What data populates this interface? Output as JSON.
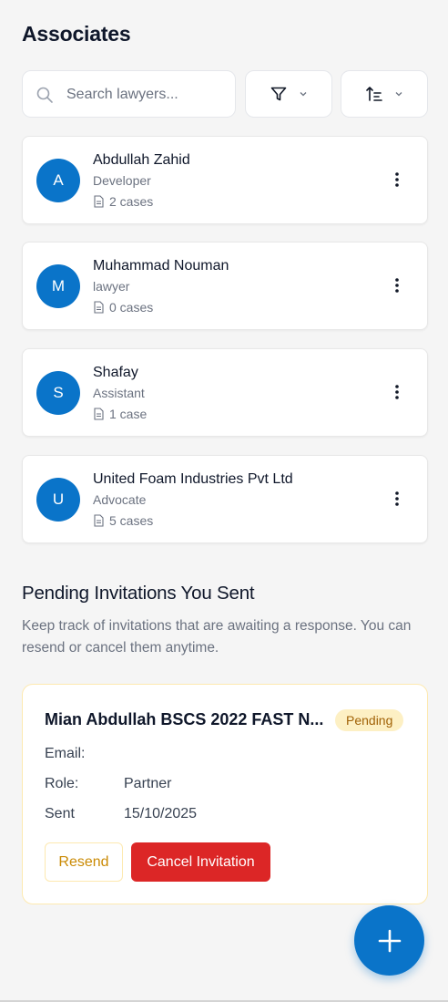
{
  "header": {
    "title": "Associates"
  },
  "search": {
    "placeholder": "Search lawyers..."
  },
  "toolbar": {
    "filter_icon": "filter-icon",
    "sort_icon": "sort-icon"
  },
  "associates": [
    {
      "initial": "A",
      "name": "Abdullah Zahid",
      "role": "Developer",
      "cases": "2 cases"
    },
    {
      "initial": "M",
      "name": "Muhammad Nouman",
      "role": "lawyer",
      "cases": "0 cases"
    },
    {
      "initial": "S",
      "name": "Shafay",
      "role": "Assistant",
      "cases": "1 case"
    },
    {
      "initial": "U",
      "name": "United Foam Industries Pvt Ltd",
      "role": "Advocate",
      "cases": "5 cases"
    }
  ],
  "pending": {
    "title": "Pending Invitations You Sent",
    "description": "Keep track of invitations that are awaiting a response. You can resend or cancel them anytime.",
    "invitation": {
      "name": "Mian Abdullah BSCS 2022 FAST N...",
      "status": "Pending",
      "email_label": "Email:",
      "email_value": "",
      "role_label": "Role:",
      "role_value": "Partner",
      "sent_label": "Sent",
      "sent_value": "15/10/2025",
      "resend_label": "Resend",
      "cancel_label": "Cancel Invitation"
    }
  },
  "colors": {
    "primary": "#0a74c9",
    "danger": "#dc2626",
    "pending_bg": "#fdf0c4",
    "pending_text": "#a16207"
  },
  "fab": {
    "icon": "plus-icon"
  }
}
